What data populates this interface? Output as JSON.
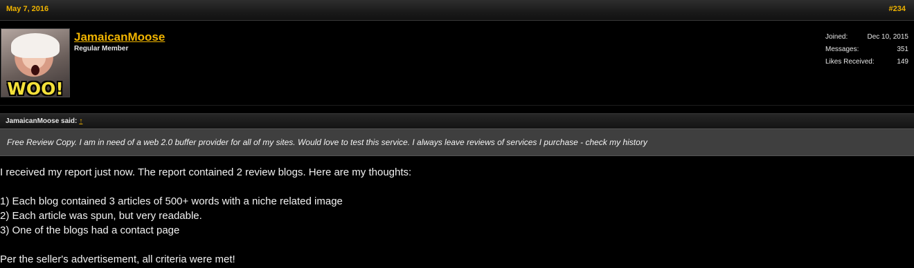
{
  "post": {
    "date": "May 7, 2016",
    "number": "#234"
  },
  "user": {
    "name": "JamaicanMoose",
    "title": "Regular Member",
    "avatar_caption": "WOO!",
    "stats": [
      {
        "label": "Joined:",
        "value": "Dec 10, 2015"
      },
      {
        "label": "Messages:",
        "value": "351"
      },
      {
        "label": "Likes Received:",
        "value": "149"
      }
    ]
  },
  "quote": {
    "author": "JamaicanMoose said:",
    "arrow": "↑",
    "text": "Free Review Copy. I am in need of a web 2.0 buffer provider for all of my sites. Would love to test this service. I always leave reviews of services I purchase - check my history"
  },
  "message": {
    "intro": "I received my report just now. The report contained 2 review blogs. Here are my thoughts:",
    "points": [
      "1) Each blog contained 3 articles of 500+ words with a niche related image",
      "2) Each article was spun, but very readable.",
      "3) One of the blogs had a contact page"
    ],
    "conclusion": "Per the seller's advertisement, all criteria were met!"
  },
  "colors": {
    "accent": "#f0b400",
    "background": "#000000",
    "quote_background": "#3f3f3f"
  }
}
